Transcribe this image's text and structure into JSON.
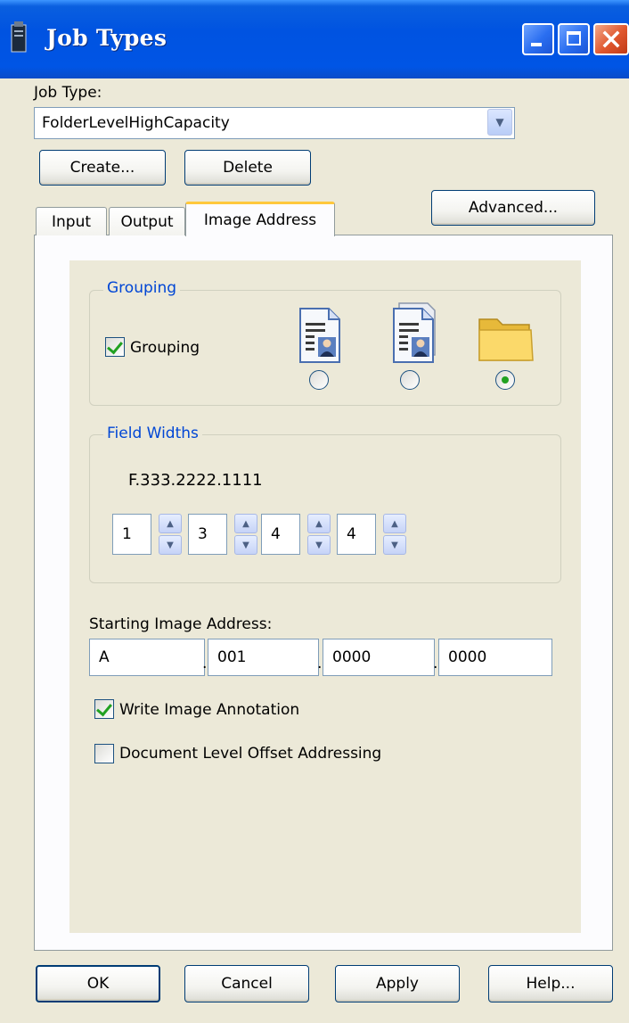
{
  "window": {
    "title": "Job Types"
  },
  "job_type": {
    "label": "Job Type:",
    "selected": "FolderLevelHighCapacity"
  },
  "buttons": {
    "create": "Create...",
    "delete": "Delete",
    "advanced": "Advanced...",
    "ok": "OK",
    "cancel": "Cancel",
    "apply": "Apply",
    "help": "Help..."
  },
  "tabs": [
    {
      "label": "Input",
      "active": false
    },
    {
      "label": "Output",
      "active": false
    },
    {
      "label": "Image Address",
      "active": true
    }
  ],
  "grouping": {
    "title": "Grouping",
    "checkbox_label": "Grouping",
    "checked": true,
    "options": [
      {
        "icon": "document-user-icon",
        "selected": false
      },
      {
        "icon": "multi-document-user-icon",
        "selected": false
      },
      {
        "icon": "folder-icon",
        "selected": true
      }
    ]
  },
  "field_widths": {
    "title": "Field Widths",
    "format": "F.333.2222.1111",
    "values": [
      "1",
      "3",
      "4",
      "4"
    ]
  },
  "starting_address": {
    "label": "Starting Image Address:",
    "fields": [
      "A",
      "001",
      "0000",
      "0000"
    ]
  },
  "options": {
    "write_annotation": {
      "label": "Write Image Annotation",
      "checked": true
    },
    "doc_offset": {
      "label": "Document Level Offset Addressing",
      "checked": false
    }
  },
  "colors": {
    "titlebar": "#0055e5",
    "dialog_bg": "#ece9d8",
    "group_title": "#0046d5",
    "check_green": "#21a121"
  }
}
